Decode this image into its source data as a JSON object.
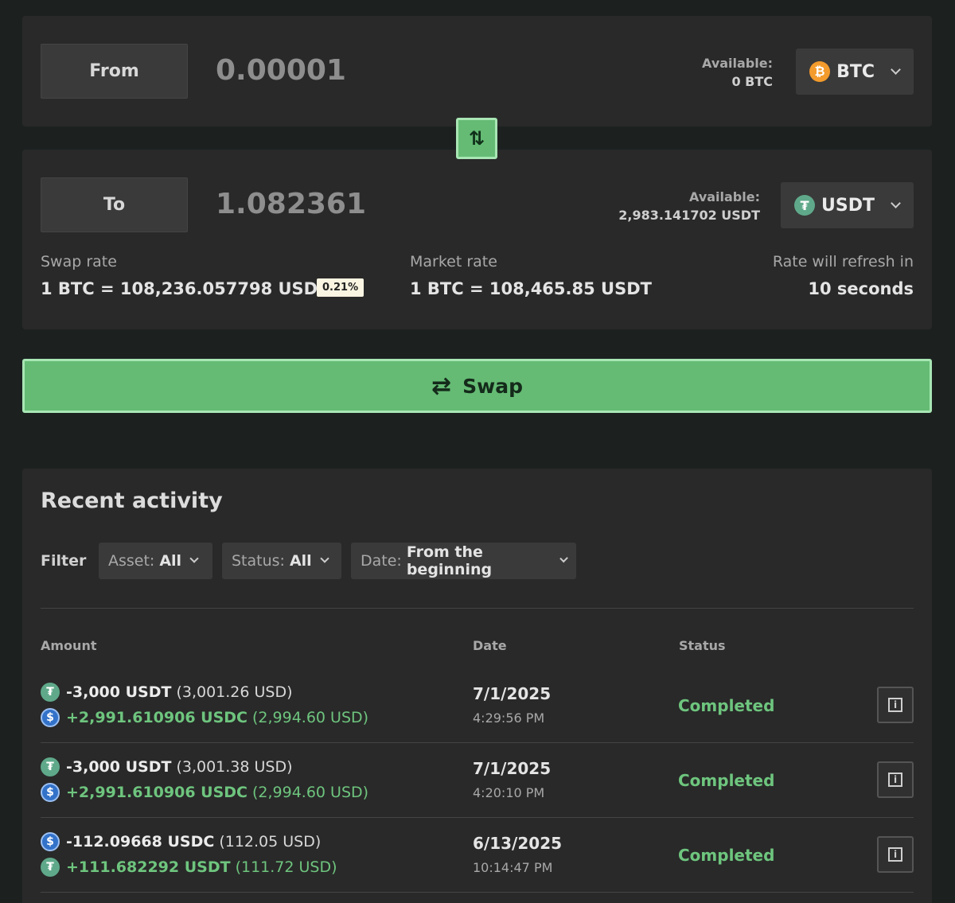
{
  "from": {
    "label": "From",
    "amount": "0.00001",
    "available_label": "Available:",
    "available_value": "0 BTC",
    "coin": "BTC",
    "coin_icon": "bitcoin-icon"
  },
  "to": {
    "label": "To",
    "amount": "1.082361",
    "available_label": "Available:",
    "available_value": "2,983.141702 USDT",
    "coin": "USDT",
    "coin_icon": "tether-icon"
  },
  "swap_direction_icon": "swap-vertical-arrows-icon",
  "rates": {
    "swap_label": "Swap rate",
    "swap_value": "1 BTC = 108,236.057798 USDT",
    "fee_badge": "0.21%",
    "market_label": "Market rate",
    "market_value": "1 BTC = 108,465.85 USDT",
    "refresh_label": "Rate will refresh in",
    "refresh_value": "10 seconds"
  },
  "swap_button": {
    "label": "Swap",
    "icon": "swap-arrows-icon"
  },
  "activity": {
    "title": "Recent activity",
    "filter_label": "Filter",
    "filters": [
      {
        "key": "Asset:",
        "value": "All"
      },
      {
        "key": "Status:",
        "value": "All"
      },
      {
        "key": "Date:",
        "value": "From the beginning"
      }
    ],
    "columns": {
      "amount": "Amount",
      "date": "Date",
      "status": "Status"
    },
    "rows": [
      {
        "out_amount": "-3,000 USDT",
        "out_usd": "(3,001.26 USD)",
        "out_coin": "USDT",
        "in_amount": "+2,991.610906 USDC",
        "in_usd": "(2,994.60 USD)",
        "in_coin": "USDC",
        "date": "7/1/2025",
        "time": "4:29:56 PM",
        "status": "Completed"
      },
      {
        "out_amount": "-3,000 USDT",
        "out_usd": "(3,001.38 USD)",
        "out_coin": "USDT",
        "in_amount": "+2,991.610906 USDC",
        "in_usd": "(2,994.60 USD)",
        "in_coin": "USDC",
        "date": "7/1/2025",
        "time": "4:20:10 PM",
        "status": "Completed"
      },
      {
        "out_amount": "-112.09668 USDC",
        "out_usd": "(112.05 USD)",
        "out_coin": "USDC",
        "in_amount": "+111.682292 USDT",
        "in_usd": "(111.72 USD)",
        "in_coin": "USDT",
        "date": "6/13/2025",
        "time": "10:14:47 PM",
        "status": "Completed"
      }
    ]
  },
  "colors": {
    "background": "#1c2120",
    "panel": "#292929",
    "accent_green": "#65bb74",
    "positive_text": "#6ec57e",
    "btc": "#f39b2c",
    "usdt": "#5fa98a",
    "usdc": "#3372c9"
  }
}
